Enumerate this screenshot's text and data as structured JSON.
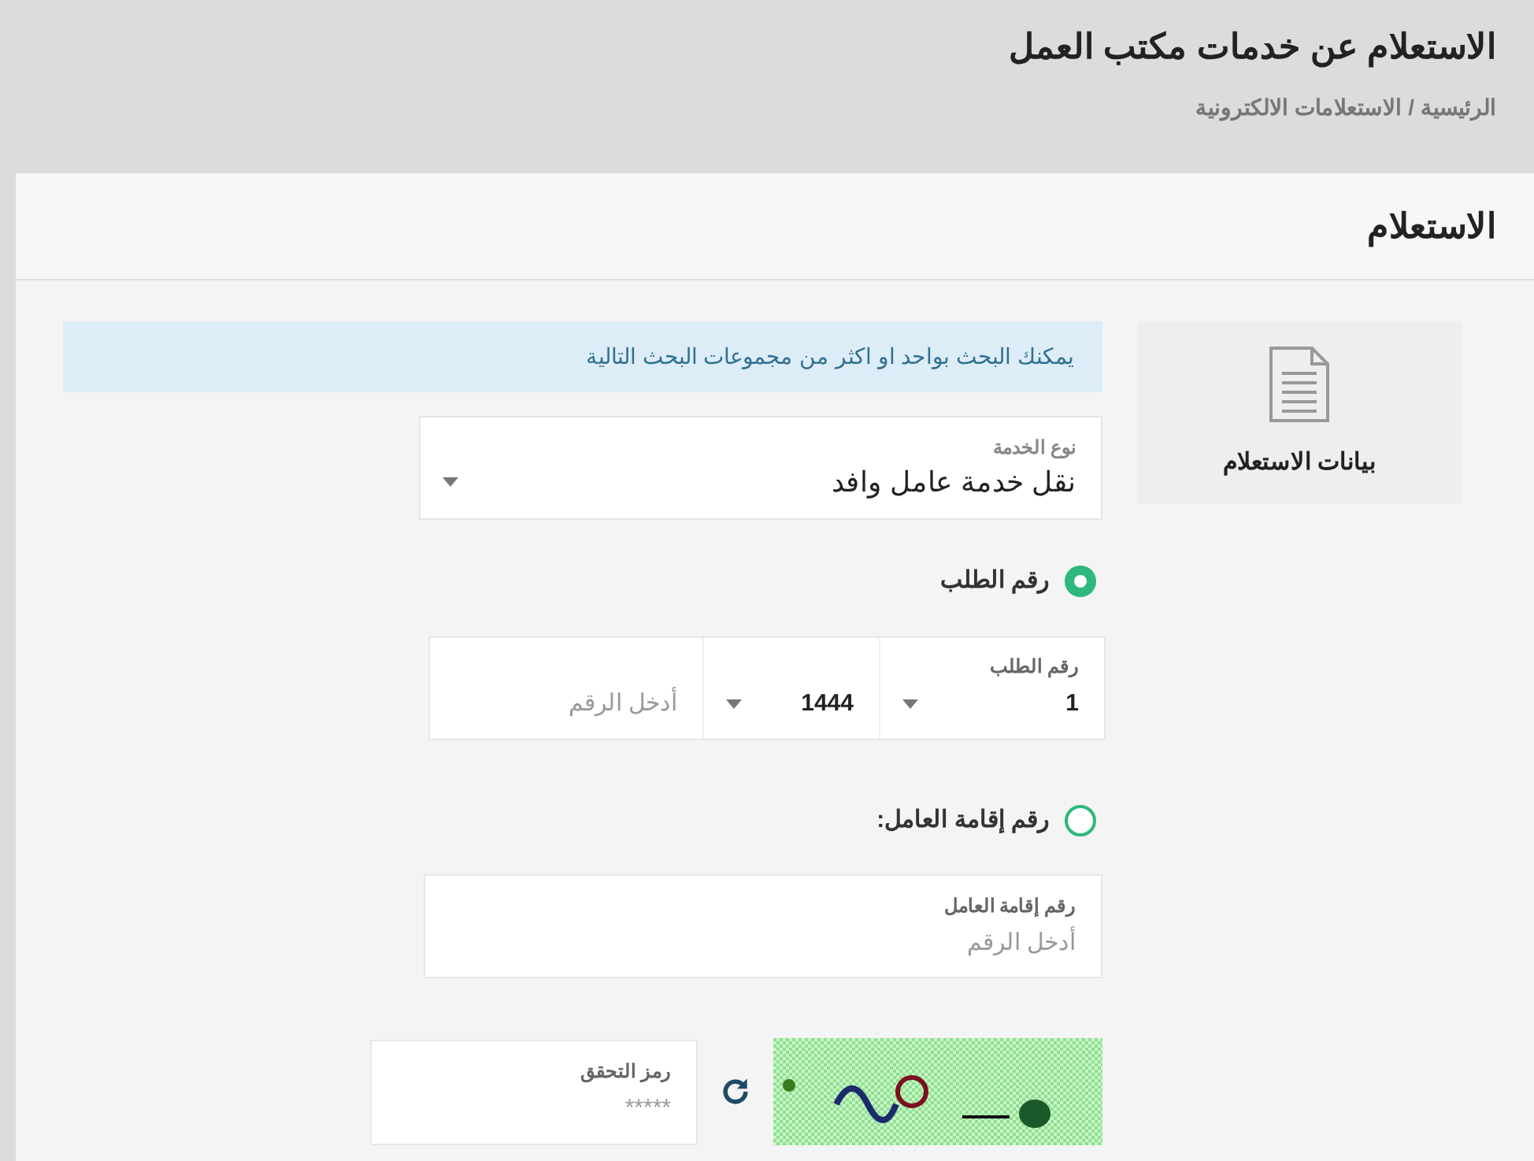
{
  "page_header": {
    "title": "الاستعلام عن خدمات مكتب العمل",
    "breadcrumb": [
      {
        "label": "الرئيسية"
      },
      {
        "label": "الاستعلامات الالكترونية"
      }
    ],
    "separator": "/"
  },
  "card": {
    "title": "الاستعلام"
  },
  "side_panel": {
    "label": "بيانات الاستعلام"
  },
  "info_message": "يمكنك البحث بواحد او اكثر من مجموعات البحث التالية",
  "service_type": {
    "label": "نوع الخدمة",
    "value": "نقل خدمة عامل وافد"
  },
  "search_options": [
    {
      "label": "رقم الطلب",
      "selected": true,
      "fields": [
        {
          "kind": "select",
          "label": "رقم الطلب",
          "value": "1"
        },
        {
          "kind": "select",
          "value": "1444"
        },
        {
          "kind": "input",
          "placeholder": "أدخل الرقم"
        }
      ]
    },
    {
      "label": "رقم إقامة العامل:",
      "selected": false,
      "fields": [
        {
          "kind": "input",
          "label": "رقم إقامة العامل",
          "placeholder": "أدخل الرقم"
        }
      ]
    }
  ],
  "captcha": {
    "label": "رمز التحقق",
    "placeholder": "*****"
  }
}
